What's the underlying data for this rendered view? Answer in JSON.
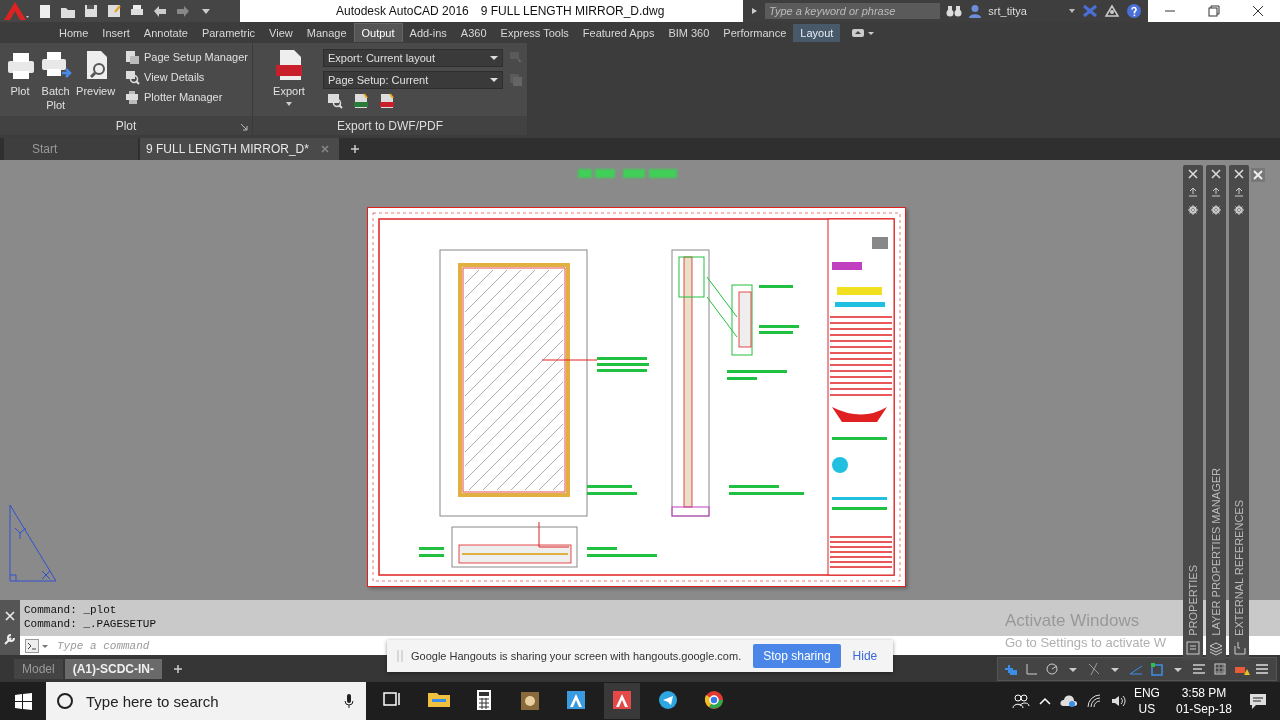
{
  "title_bar": {
    "app_title": "Autodesk AutoCAD 2016",
    "file_title": "9 FULL LENGTH MIRROR_D.dwg",
    "search": {
      "placeholder": "Type a keyword or phrase"
    },
    "user": "srt_titya"
  },
  "ribbon_tabs": [
    {
      "label": "Home",
      "selected": false,
      "contextual": false
    },
    {
      "label": "Insert",
      "selected": false,
      "contextual": false
    },
    {
      "label": "Annotate",
      "selected": false,
      "contextual": false
    },
    {
      "label": "Parametric",
      "selected": false,
      "contextual": false
    },
    {
      "label": "View",
      "selected": false,
      "contextual": false
    },
    {
      "label": "Manage",
      "selected": false,
      "contextual": false
    },
    {
      "label": "Output",
      "selected": true,
      "contextual": false
    },
    {
      "label": "Add-ins",
      "selected": false,
      "contextual": false
    },
    {
      "label": "A360",
      "selected": false,
      "contextual": false
    },
    {
      "label": "Express Tools",
      "selected": false,
      "contextual": false
    },
    {
      "label": "Featured Apps",
      "selected": false,
      "contextual": false
    },
    {
      "label": "BIM 360",
      "selected": false,
      "contextual": false
    },
    {
      "label": "Performance",
      "selected": false,
      "contextual": false
    },
    {
      "label": "Layout",
      "selected": false,
      "contextual": true
    }
  ],
  "plot_panel": {
    "title": "Plot",
    "large_buttons": [
      {
        "label": "Plot",
        "kind": "plot"
      },
      {
        "label": "Batch Plot",
        "kind": "batch"
      },
      {
        "label": "Preview",
        "kind": "preview"
      }
    ],
    "small_buttons": [
      {
        "label": "Page Setup Manager",
        "kind": "setup"
      },
      {
        "label": "View Details",
        "kind": "details"
      },
      {
        "label": "Plotter Manager",
        "kind": "plotter"
      }
    ]
  },
  "export_panel": {
    "title": "Export to DWF/PDF",
    "export_button": "Export",
    "dropdowns": [
      "Export: Current layout",
      "Page Setup: Current"
    ]
  },
  "file_tabs": [
    {
      "label": "Start",
      "selected": false
    },
    {
      "label": "9 FULL LENGTH MIRROR_D*",
      "selected": true
    }
  ],
  "palettes": [
    {
      "title": "PROPERTIES",
      "kind": "properties"
    },
    {
      "title": "LAYER PROPERTIES MANAGER",
      "kind": "layers"
    },
    {
      "title": "EXTERNAL REFERENCES",
      "kind": "xref"
    }
  ],
  "command_line": {
    "history": [
      "Command: _plot",
      "Command: _.PAGESETUP"
    ],
    "placeholder": "Type a command"
  },
  "layout_tabs": [
    {
      "label": "Model",
      "selected": false
    },
    {
      "label": "(A1)-SCDC-IN-",
      "selected": true
    }
  ],
  "activation_notice": {
    "title": "Activate Windows",
    "message": "Go to Settings to activate W"
  },
  "hangouts_bar": {
    "message": "Google Hangouts is sharing your screen with hangouts.google.com.",
    "stop_button": "Stop sharing",
    "hide_link": "Hide"
  },
  "taskbar": {
    "search": {
      "placeholder": "Type here to search"
    },
    "language": "ENG",
    "region": "US",
    "time": "3:58 PM",
    "date": "01-Sep-18"
  }
}
